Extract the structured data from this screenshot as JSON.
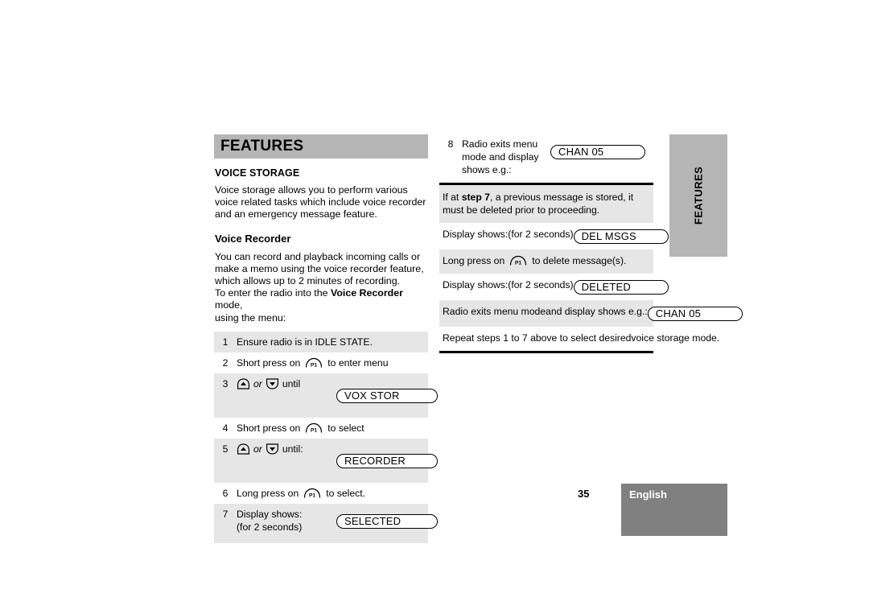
{
  "chapter": {
    "title": "FEATURES",
    "thumb_tab_label": "FEATURES"
  },
  "left_column": {
    "section_heading": "VOICE STORAGE",
    "intro_paragraph": "Voice storage allows you to perform various voice related tasks which include voice recorder and an emergency message feature.",
    "sub_heading": "Voice Recorder",
    "body_line_1": "You can record and playback incoming calls or",
    "body_line_2": "make a memo using the voice recorder feature,",
    "body_line_3": "which allows up to 2 minutes of recording.",
    "body_line_4_pre": "To enter the radio into the ",
    "body_line_4_bold": "Voice Recorder",
    "body_line_4_post": " mode,",
    "body_line_5": "using the menu:",
    "steps": [
      {
        "number": "1",
        "text": "Ensure radio is in IDLE STATE.",
        "shaded": true
      },
      {
        "number": "2",
        "text_pre": "Short press on",
        "key": "P1",
        "text_post": "to enter menu",
        "shaded": false
      },
      {
        "number": "3",
        "key_up": "up-arrow",
        "conj": "or",
        "key_down": "down-arrow",
        "text_post": "until",
        "display": "VOX STOR",
        "shaded": true
      },
      {
        "number": "4",
        "text_pre": "Short press on",
        "key": "P1",
        "text_post": "to select",
        "shaded": false
      },
      {
        "number": "5",
        "key_up": "up-arrow",
        "conj": "or",
        "key_down": "down-arrow",
        "text_post": "until:",
        "display": "RECORDER",
        "shaded": true
      },
      {
        "number": "6",
        "text_pre": "Long press on",
        "key": "P1",
        "text_post": "to select.",
        "shaded": false
      },
      {
        "number": "7",
        "line_1": "Display shows:",
        "line_2": "(for 2 seconds)",
        "display": "SELECTED",
        "shaded": true
      }
    ]
  },
  "right_column": {
    "step_8": {
      "number": "8",
      "line_1": "Radio exits menu",
      "line_2": "mode and display",
      "line_3": "shows e.g.:",
      "display": "CHAN  05"
    },
    "note": {
      "pre": "If at ",
      "bold": "step 7",
      "post": ", a previous message is stored, it must be deleted prior to proceeding."
    },
    "rows": [
      {
        "line_1": "Display shows:",
        "line_2": "(for 2 seconds)",
        "display": "DEL MSGS",
        "shaded": false
      },
      {
        "text_pre": "Long press on",
        "key": "P1",
        "text_post": "to delete message(s).",
        "shaded": true
      },
      {
        "line_1": "Display shows:",
        "line_2": "(for 2 seconds)",
        "display": "DELETED",
        "shaded": false
      },
      {
        "line_1": "Radio exits menu mode",
        "line_2": "and display shows e.g.:",
        "display": "CHAN  05",
        "shaded": true
      },
      {
        "line_1": "Repeat steps 1 to 7 above to select desired",
        "line_2": "voice storage mode.",
        "shaded": false
      }
    ]
  },
  "footer": {
    "page_number": "35",
    "language": "English"
  },
  "colors": {
    "header_gray": "#b5b5b5",
    "row_gray": "#e6e6e6",
    "footer_gray": "#808080"
  }
}
